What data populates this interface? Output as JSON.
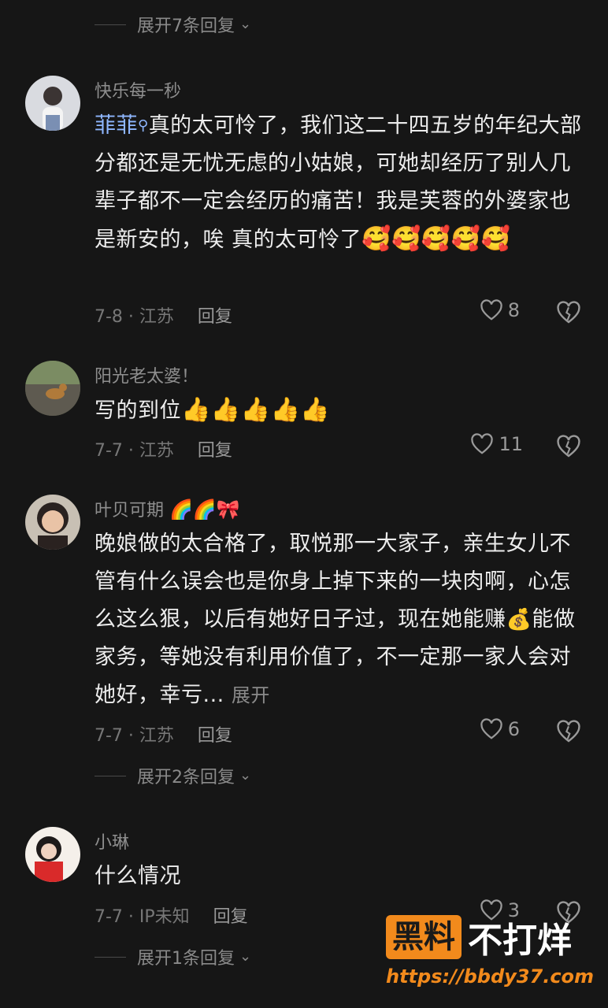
{
  "top_expand": {
    "label": "展开7条回复"
  },
  "comments": [
    {
      "username": "快乐每一秒",
      "mention": "菲菲",
      "text": "真的太可怜了，我们这二十四五岁的年纪大部分都还是无忧无虑的小姑娘，可她却经历了别人几辈子都不一定会经历的痛苦！我是芙蓉的外婆家也是新安的，唉 真的太可怜了",
      "emojis": "🥰🥰🥰🥰🥰",
      "meta": "7-8 · 江苏",
      "reply": "回复",
      "likes": "8"
    },
    {
      "username": "阳光老太婆！",
      "text": "写的到位",
      "emojis": "👍👍👍👍👍",
      "meta": "7-7 · 江苏",
      "reply": "回复",
      "likes": "11"
    },
    {
      "username": "叶贝可期",
      "username_emojis": "🌈🌈🎀",
      "text": "晚娘做的太合格了，取悦那一大家子，亲生女儿不管有什么误会也是你身上掉下来的一块肉啊，心怎么这么狠，以后有她好日子过，现在她能赚",
      "money_emoji": "💰",
      "text2": "能做家务，等她没有利用价值了，不一定那一家人会对她好，幸亏...",
      "expand": "展开",
      "meta": "7-7 · 江苏",
      "reply": "回复",
      "likes": "6",
      "replies_expand": "展开2条回复"
    },
    {
      "username": "小琳",
      "text": "什么情况",
      "meta": "7-7 · IP未知",
      "reply": "回复",
      "likes": "3",
      "replies_expand": "展开1条回复"
    }
  ],
  "watermark": {
    "brand_box": "黑料",
    "brand_title": "不打烊",
    "url": "https://bbdy37.com"
  },
  "colors": {
    "background": "#161616",
    "mention": "#8fb7ff",
    "watermark_orange": "#f28a1c"
  }
}
